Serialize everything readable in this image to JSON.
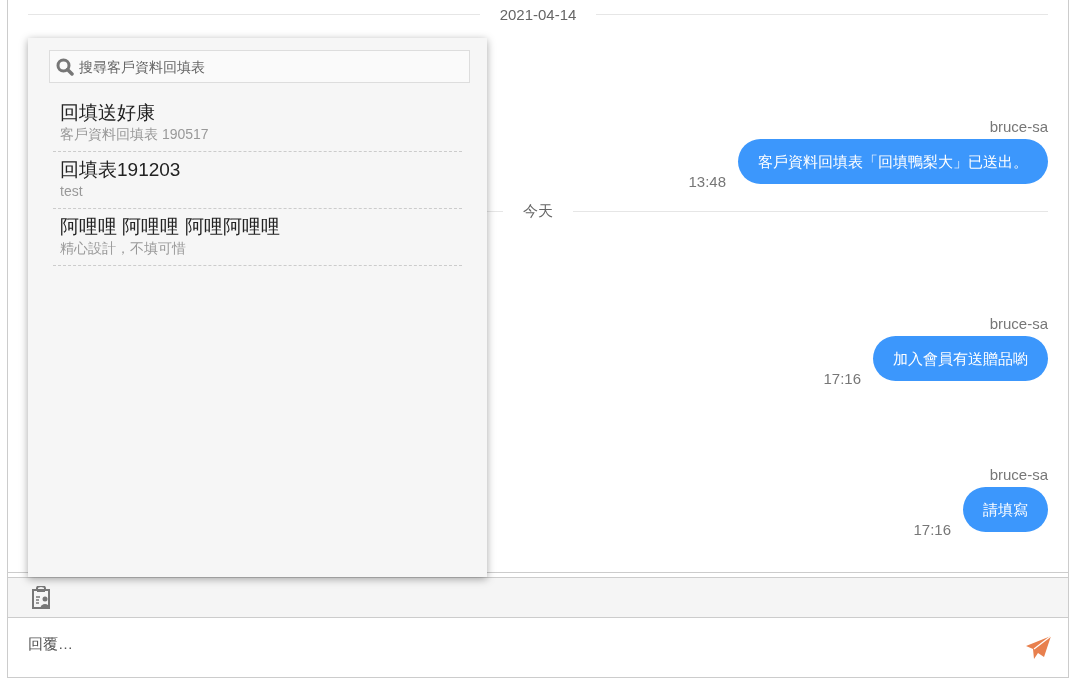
{
  "chat": [
    {
      "kind": "date",
      "label": "2021-04-14"
    },
    {
      "kind": "message",
      "sender": "bruce-sa",
      "time": "13:48",
      "text": "客戶資料回填表「回填鴨梨大」已送出。"
    },
    {
      "kind": "date",
      "label": "今天"
    },
    {
      "kind": "message",
      "sender": "bruce-sa",
      "time": "17:16",
      "text": "加入會員有送贈品喲"
    },
    {
      "kind": "message",
      "sender": "bruce-sa",
      "time": "17:16",
      "text": "請填寫"
    }
  ],
  "form_picker": {
    "search": {
      "placeholder": "搜尋客戶資料回填表"
    },
    "forms": [
      {
        "title": "回填送好康",
        "subtitle": "客戶資料回填表 190517"
      },
      {
        "title": "回填表191203",
        "subtitle": "test"
      },
      {
        "title": "阿哩哩 阿哩哩 阿哩阿哩哩",
        "subtitle": "精心設計，不填可惜"
      }
    ]
  },
  "reply": {
    "placeholder": "回覆…"
  }
}
